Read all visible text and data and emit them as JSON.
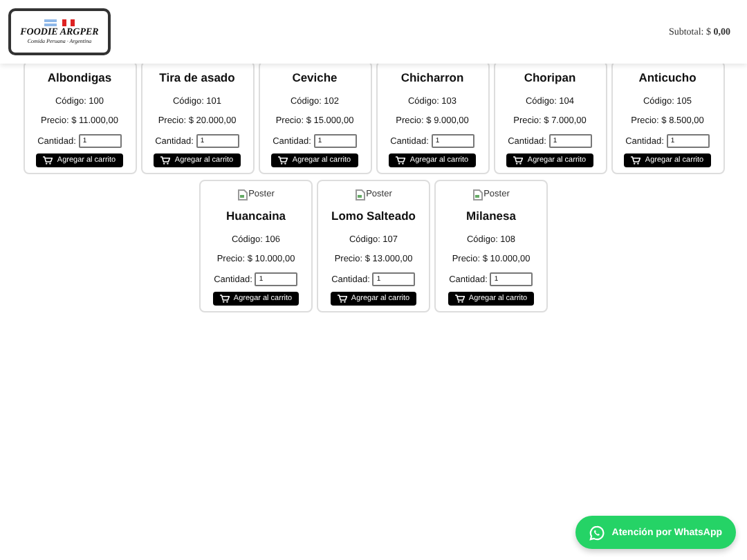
{
  "header": {
    "logo": {
      "title": "FOODIE ARGPER",
      "subtitle": "Comida Peruana · Argentina"
    },
    "subtotal": "Subtotal: $ **0,00**"
  },
  "products": [
    {
      "name": "Albondigas",
      "code": "Código: 100",
      "price": "Precio: $ 11.000,00",
      "quantity_label": "Cantidad:",
      "quantity": "1",
      "button": "Agregar al carrito"
    },
    {
      "name": "Tira de asado",
      "code": "Código: 101",
      "price": "Precio: $ 20.000,00",
      "quantity_label": "Cantidad:",
      "quantity": "1",
      "button": "Agregar al carrito"
    },
    {
      "name": "Ceviche",
      "code": "Código: 102",
      "price": "Precio: $ 15.000,00",
      "quantity_label": "Cantidad:",
      "quantity": "1",
      "button": "Agregar al carrito"
    },
    {
      "name": "Chicharron",
      "code": "Código: 103",
      "price": "Precio: $ 9.000,00",
      "quantity_label": "Cantidad:",
      "quantity": "1",
      "button": "Agregar al carrito"
    },
    {
      "name": "Choripan",
      "code": "Código: 104",
      "price": "Precio: $ 7.000,00",
      "quantity_label": "Cantidad:",
      "quantity": "1",
      "button": "Agregar al carrito"
    },
    {
      "name": "Anticucho",
      "code": "Código: 105",
      "price": "Precio: $ 8.500,00",
      "quantity_label": "Cantidad:",
      "quantity": "1",
      "button": "Agregar al carrito"
    },
    {
      "poster": "Poster",
      "name": "Huancaina",
      "code": "Código: 106",
      "price": "Precio: $ 10.000,00",
      "quantity_label": "Cantidad:",
      "quantity": "1",
      "button": "Agregar al carrito"
    },
    {
      "poster": "Poster",
      "name": "Lomo Salteado",
      "code": "Código: 107",
      "price": "Precio: $ 13.000,00",
      "quantity_label": "Cantidad:",
      "quantity": "1",
      "button": "Agregar al carrito"
    },
    {
      "poster": "Poster",
      "name": "Milanesa",
      "code": "Código: 108",
      "price": "Precio: $ 10.000,00",
      "quantity_label": "Cantidad:",
      "quantity": "1",
      "button": "Agregar al carrito"
    }
  ],
  "whatsapp_button": "Atención por WhatsApp"
}
